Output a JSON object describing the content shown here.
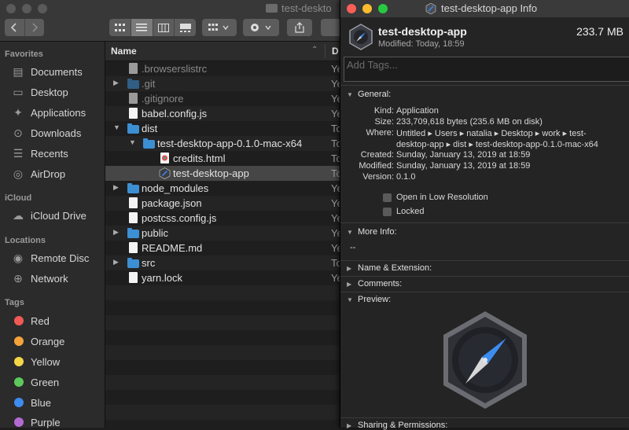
{
  "finder": {
    "window_title": "test-deskto",
    "sidebar": {
      "favorites_header": "Favorites",
      "favorites": [
        {
          "label": "Documents",
          "icon": "documents-icon"
        },
        {
          "label": "Desktop",
          "icon": "desktop-icon"
        },
        {
          "label": "Applications",
          "icon": "applications-icon"
        },
        {
          "label": "Downloads",
          "icon": "downloads-icon"
        },
        {
          "label": "Recents",
          "icon": "recents-icon"
        },
        {
          "label": "AirDrop",
          "icon": "airdrop-icon"
        }
      ],
      "icloud_header": "iCloud",
      "icloud": [
        {
          "label": "iCloud Drive",
          "icon": "cloud-icon"
        }
      ],
      "locations_header": "Locations",
      "locations": [
        {
          "label": "Remote Disc",
          "icon": "disc-icon"
        },
        {
          "label": "Network",
          "icon": "network-icon"
        }
      ],
      "tags_header": "Tags",
      "tags": [
        {
          "label": "Red",
          "color": "#f05a55"
        },
        {
          "label": "Orange",
          "color": "#f5a33a"
        },
        {
          "label": "Yellow",
          "color": "#f3d548"
        },
        {
          "label": "Green",
          "color": "#5ec95b"
        },
        {
          "label": "Blue",
          "color": "#3d8cf0"
        },
        {
          "label": "Purple",
          "color": "#b56ad1"
        }
      ]
    },
    "columns": {
      "name": "Name",
      "date": "D"
    },
    "files": [
      {
        "name": ".browserslistrc",
        "date": "Ye",
        "type": "doc-gray",
        "level": 0,
        "disclosure": "",
        "dim": true
      },
      {
        "name": ".git",
        "date": "Ye",
        "type": "folder",
        "level": 0,
        "disclosure": "▶",
        "dim": true
      },
      {
        "name": ".gitignore",
        "date": "Ye",
        "type": "doc-gray",
        "level": 0,
        "disclosure": "",
        "dim": true
      },
      {
        "name": "babel.config.js",
        "date": "Ye",
        "type": "doc",
        "level": 0,
        "disclosure": "",
        "dim": false
      },
      {
        "name": "dist",
        "date": "To",
        "type": "folder",
        "level": 0,
        "disclosure": "▼",
        "dim": false
      },
      {
        "name": "test-desktop-app-0.1.0-mac-x64",
        "date": "To",
        "type": "folder",
        "level": 1,
        "disclosure": "▼",
        "dim": false
      },
      {
        "name": "credits.html",
        "date": "To",
        "type": "html",
        "level": 2,
        "disclosure": "",
        "dim": false
      },
      {
        "name": "test-desktop-app",
        "date": "To",
        "type": "app",
        "level": 2,
        "disclosure": "",
        "dim": false,
        "selected": true
      },
      {
        "name": "node_modules",
        "date": "Ye",
        "type": "folder",
        "level": 0,
        "disclosure": "▶",
        "dim": false
      },
      {
        "name": "package.json",
        "date": "Ye",
        "type": "doc",
        "level": 0,
        "disclosure": "",
        "dim": false
      },
      {
        "name": "postcss.config.js",
        "date": "Ye",
        "type": "doc",
        "level": 0,
        "disclosure": "",
        "dim": false
      },
      {
        "name": "public",
        "date": "Ye",
        "type": "folder",
        "level": 0,
        "disclosure": "▶",
        "dim": false
      },
      {
        "name": "README.md",
        "date": "Ye",
        "type": "doc",
        "level": 0,
        "disclosure": "",
        "dim": false
      },
      {
        "name": "src",
        "date": "To",
        "type": "folder",
        "level": 0,
        "disclosure": "▶",
        "dim": false
      },
      {
        "name": "yarn.lock",
        "date": "Ye",
        "type": "doc",
        "level": 0,
        "disclosure": "",
        "dim": false
      }
    ]
  },
  "info": {
    "window_title": "test-desktop-app Info",
    "app_name": "test-desktop-app",
    "size": "233.7 MB",
    "modified": "Modified: Today, 18:59",
    "tags_placeholder": "Add Tags...",
    "general_header": "General:",
    "general": [
      {
        "key": "Kind:",
        "value": "Application"
      },
      {
        "key": "Size:",
        "value": "233,709,618 bytes (235.6 MB on disk)"
      },
      {
        "key": "Where:",
        "value": "Untitled ▸ Users ▸ natalia ▸ Desktop ▸ work ▸ test-"
      },
      {
        "key": "",
        "value": "desktop-app ▸ dist ▸ test-desktop-app-0.1.0-mac-x64"
      },
      {
        "key": "Created:",
        "value": "Sunday, January 13, 2019 at 18:59"
      },
      {
        "key": "Modified:",
        "value": "Sunday, January 13, 2019 at 18:59"
      },
      {
        "key": "Version:",
        "value": "0.1.0"
      }
    ],
    "open_low_res": "Open in Low Resolution",
    "locked": "Locked",
    "more_info_header": "More Info:",
    "more_info_value": "--",
    "name_ext_header": "Name & Extension:",
    "comments_header": "Comments:",
    "preview_header": "Preview:",
    "sharing_header": "Sharing & Permissions:"
  }
}
